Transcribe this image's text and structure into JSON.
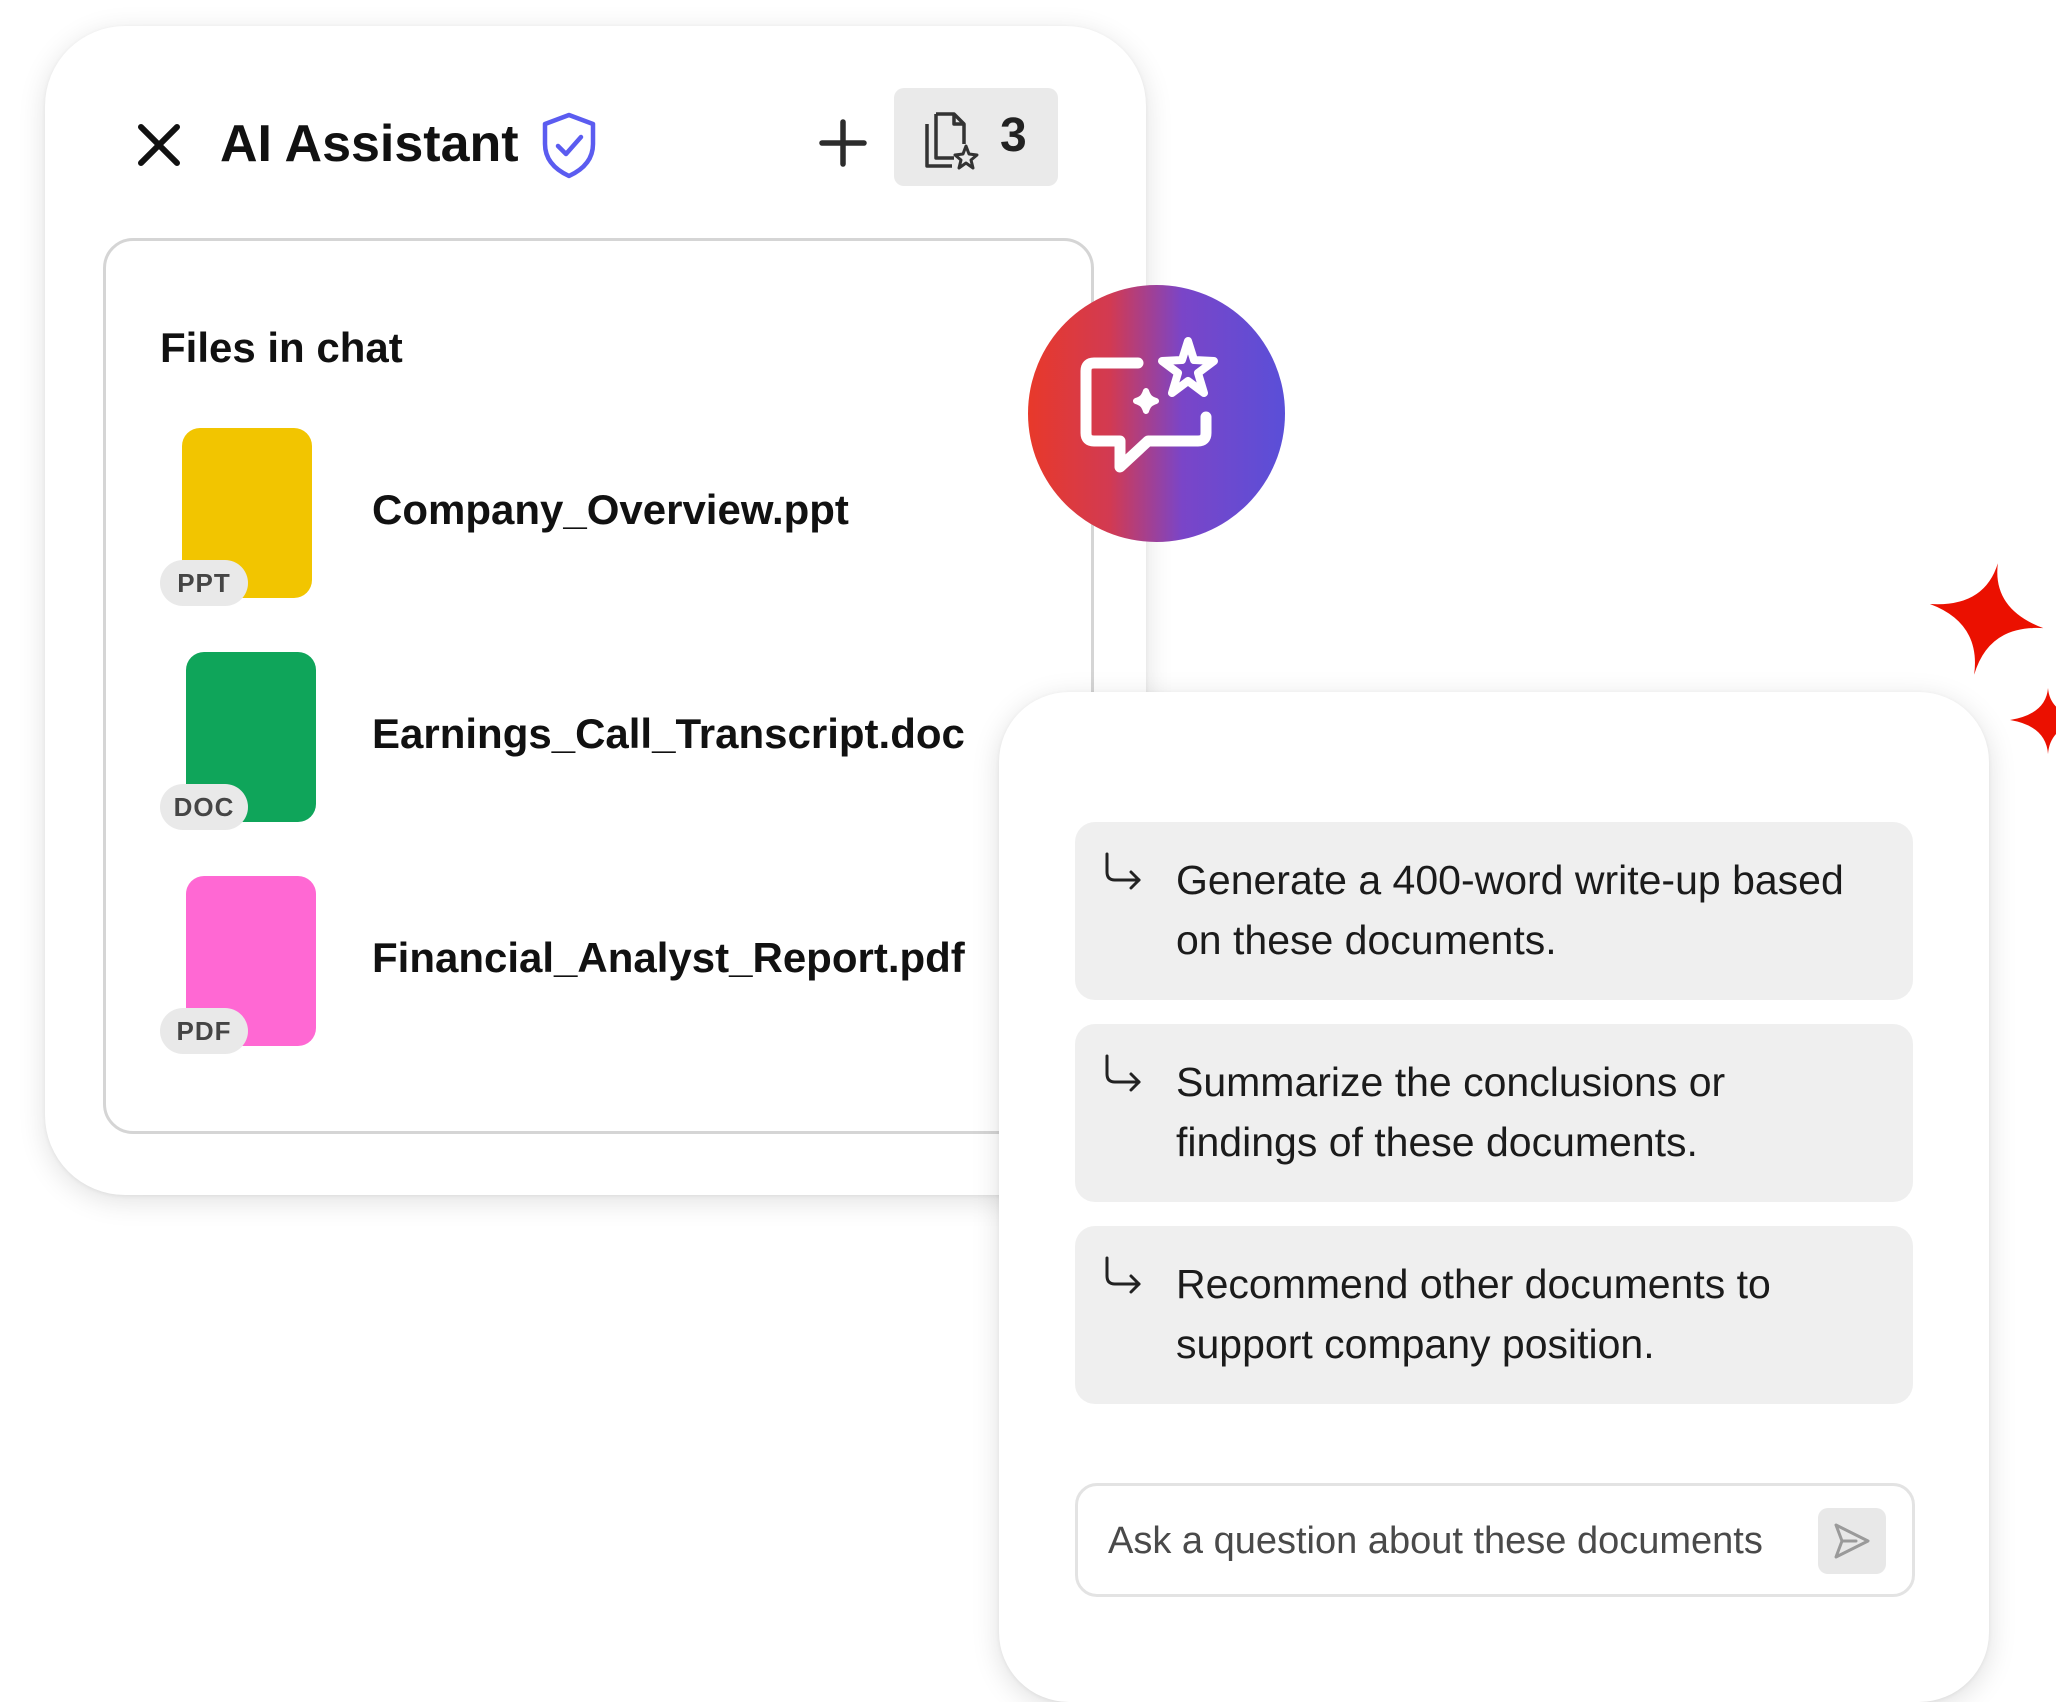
{
  "header": {
    "title": "AI Assistant",
    "file_count": "3"
  },
  "files_panel": {
    "heading": "Files in chat",
    "files": [
      {
        "name": "Company_Overview.ppt",
        "type_badge": "PPT",
        "color": "#f2c500"
      },
      {
        "name": "Earnings_Call_Transcript.doc",
        "type_badge": "DOC",
        "color": "#0fa55a"
      },
      {
        "name": "Financial_Analyst_Report.pdf",
        "type_badge": "PDF",
        "color": "#ff68d3"
      }
    ]
  },
  "suggestions": [
    {
      "text": "Generate a 400-word write-up based on these documents.",
      "icon": "arrow-return-right-icon"
    },
    {
      "text": "Summarize the conclusions or findings of these documents.",
      "icon": "arrow-return-right-icon"
    },
    {
      "text": "Recommend other documents to support company position.",
      "icon": "arrow-return-right-icon"
    }
  ],
  "ask": {
    "placeholder": "Ask a question about these documents",
    "value": ""
  },
  "icons": {
    "close": "close-icon",
    "shield": "shield-check-icon",
    "add": "plus-icon",
    "files": "files-sparkle-icon",
    "ai_chat": "ai-chat-sparkle-icon",
    "send": "send-icon",
    "decor": "sparkle-icon"
  },
  "colors": {
    "shield": "#5b5cf0",
    "sparkle": "#eb1000",
    "badge_gradient_start": "#e8392a",
    "badge_gradient_end": "#5a4fd8",
    "prompt_bg": "#efefef"
  }
}
